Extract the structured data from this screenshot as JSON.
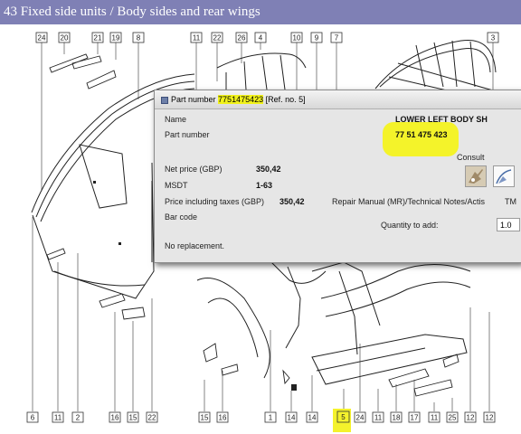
{
  "window": {
    "title": "43 Fixed side units / Body sides and rear wings"
  },
  "popup": {
    "title_prefix": "Part number",
    "part_number_highlight": "7751475423",
    "ref": "[Ref. no. 5]",
    "labels": {
      "name": "Name",
      "part_number": "Part number",
      "net_price": "Net price (GBP)",
      "msdt": "MSDT",
      "price_incl": "Price including taxes (GBP)",
      "bar_code": "Bar code",
      "replacement": "No replacement."
    },
    "values": {
      "name": "LOWER LEFT BODY SH",
      "part_number": "77 51 475 423",
      "net_price": "350,42",
      "msdt": "1-63",
      "price_incl": "350,42"
    },
    "consult_label": "Consult",
    "repair_manual_label": "Repair Manual (MR)/Technical Notes/Actis",
    "tm_label": "TM",
    "quantity_label": "Quantity to add:",
    "quantity_value": "1.0",
    "icons": [
      "repair-manual-icon",
      "technical-manual-icon",
      "window-icon"
    ]
  },
  "diagram": {
    "top_callouts": [
      "24",
      "20",
      "21",
      "19",
      "8",
      "11",
      "22",
      "26",
      "4",
      "10",
      "9",
      "7",
      "3"
    ],
    "bottom_callouts": [
      "6",
      "11",
      "2",
      "16",
      "15",
      "22",
      "15",
      "16",
      "1",
      "14",
      "14",
      "5",
      "24",
      "11",
      "18",
      "17",
      "11",
      "25",
      "12"
    ],
    "highlighted_callout": "5",
    "highlight_color": "#f4f22c",
    "title_bar_color": "#7f80b5"
  }
}
